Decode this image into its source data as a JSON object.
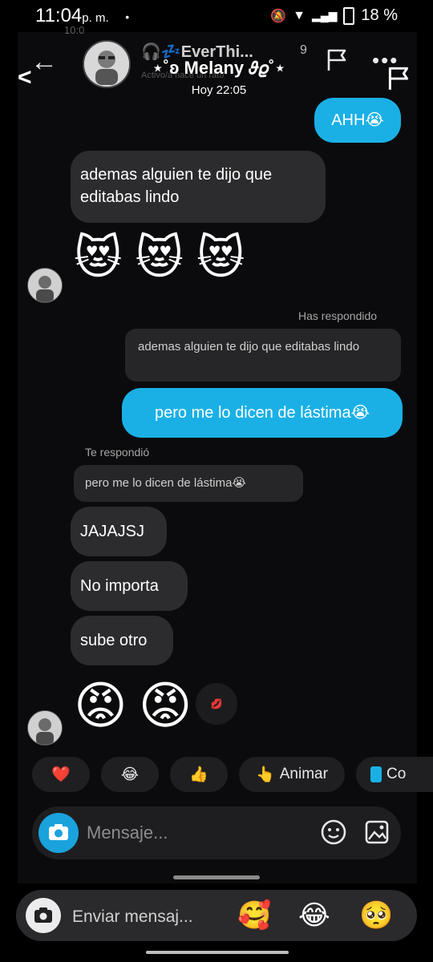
{
  "status": {
    "time_main": "11:04",
    "time_suffix": "p. m.",
    "dot": "•",
    "battery": "18 %",
    "ghost_time": "10:0"
  },
  "inner_header": {
    "back": "←",
    "name": "🎧💤EverThi...",
    "followers": "9",
    "subtitle": "Activo/a hace un rato",
    "dots": "•••"
  },
  "overlay_header": {
    "back": "<",
    "name": "⋆˚ʚ Melany 𝜗𝜚˚⋆",
    "time": "Hoy 22:05"
  },
  "messages": {
    "m1": "AHH😭",
    "m2": "ademas alguien te dijo que editabas lindo",
    "replied_label": "Has respondido",
    "quote1": "ademas alguien te dijo que editabas lindo",
    "m3": "pero me lo dicen de lástima😭",
    "reply_label2": "Te respondió",
    "quote2": "pero me lo dicen de lástima😭",
    "m4": "JAJAJSJ",
    "m5": "No importa",
    "m6": "sube otro"
  },
  "emojis": {
    "cats": [
      "😻",
      "😻",
      "😻"
    ],
    "angry": [
      "😡",
      "😡"
    ],
    "reaction": "💋"
  },
  "quick_replies": {
    "heart": "❤️",
    "laugh": "😂",
    "thumbs": "👍",
    "animar_icon": "👆",
    "animar": "Animar",
    "co": "Co"
  },
  "composer": {
    "placeholder": "Mensaje..."
  },
  "bottom": {
    "placeholder": "Enviar mensaj...",
    "e1": "🥰",
    "e2": "😂",
    "e3": "🥺"
  },
  "colors": {
    "accent": "#1ab0e6",
    "bubble_received": "#2c2c2e"
  }
}
